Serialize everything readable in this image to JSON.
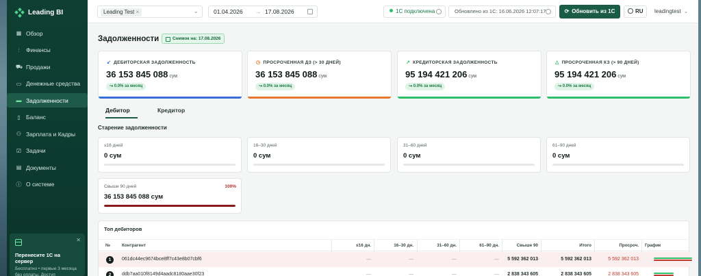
{
  "app": {
    "brand": "Leading BI"
  },
  "sidebar": {
    "items": [
      {
        "label": "Обзор",
        "icon": "grid-icon"
      },
      {
        "label": "Финансы",
        "icon": "bar-chart-icon"
      },
      {
        "label": "Продажи",
        "icon": "cart-icon"
      },
      {
        "label": "Денежные средства",
        "icon": "wallet-icon"
      },
      {
        "label": "Задолженности",
        "icon": "credit-card-icon",
        "active": true
      },
      {
        "label": "Баланс",
        "icon": "book-icon"
      },
      {
        "label": "Зарплата и Кадры",
        "icon": "users-icon"
      },
      {
        "label": "Задачи",
        "icon": "checkbox-icon"
      },
      {
        "label": "Документы",
        "icon": "document-icon"
      },
      {
        "label": "О системе",
        "icon": "info-icon"
      }
    ],
    "promo": {
      "title": "Перенесите 1С на сервер",
      "text": "Бесплатно • первые 3 месяца без оплаты. Доступ"
    }
  },
  "header": {
    "company": "Leading Test",
    "date_from": "01.04.2026",
    "date_to": "17.08.2026",
    "connection": "1С подключена",
    "updated": "Обновлено из 1С: 16.06.2026 12:07:17",
    "refresh_label": "Обновить из 1С",
    "lang": "RU",
    "user": "leadingtest"
  },
  "page": {
    "title": "Задолженности",
    "snapshot": "Снимок на: 17.08.2026"
  },
  "kpis": [
    {
      "label": "ДЕБИТОРСКАЯ ЗАДОЛЖЕННОСТЬ",
      "value": "36 153 845 088",
      "unit": "сум",
      "delta": "0.0% за месяц",
      "color": "#3b6fd8",
      "icon": "↙"
    },
    {
      "label": "ПРОСРОЧЕННАЯ ДЗ (> 30 ДНЕЙ)",
      "value": "36 153 845 088",
      "unit": "сум",
      "delta": "0.0% за месяц",
      "color": "#e8782d",
      "icon": "◷"
    },
    {
      "label": "КРЕДИТОРСКАЯ ЗАДОЛЖЕННОСТЬ",
      "value": "95 194 421 206",
      "unit": "сум",
      "delta": "0.0% за месяц",
      "color": "#2fbf6b",
      "icon": "↗"
    },
    {
      "label": "ПРОСРОЧЕННАЯ КЗ (> 90 ДНЕЙ)",
      "value": "95 194 421 206",
      "unit": "сум",
      "delta": "0.0% за месяц",
      "color": "#2fbf6b",
      "icon": "△"
    }
  ],
  "tabs": [
    {
      "label": "Дебитор",
      "active": true
    },
    {
      "label": "Кредитор",
      "active": false
    }
  ],
  "aging": {
    "title": "Старение задолженности",
    "buckets": [
      {
        "label": "≤16 дней",
        "value": "0 сум",
        "fill": 0
      },
      {
        "label": "16–30 дней",
        "value": "0 сум",
        "fill": 0
      },
      {
        "label": "31–60 дней",
        "value": "0 сум",
        "fill": 0
      },
      {
        "label": "61–90 дней",
        "value": "0 сум",
        "fill": 0
      },
      {
        "label": "Свыше 90 дней",
        "value": "36 153 845 088 сум",
        "pct": "100%",
        "fill": 1
      }
    ]
  },
  "top": {
    "title": "Топ дебиторов",
    "columns": [
      "№",
      "Контрагент",
      "≤16 дн.",
      "16–30 дн.",
      "31–60 дн.",
      "61–90 дн.",
      "Свыше 90",
      "Итого",
      "Просроч.",
      "График"
    ],
    "rows": [
      {
        "rank": "1",
        "name": "061dc44ec9674bce8ff7c43e8b07cbf6",
        "c1": "—",
        "c2": "—",
        "c3": "—",
        "c4": "—",
        "over90": "5 592 362 013",
        "total": "5 592 362 013",
        "overdue": "5 592 362 013",
        "bar_a": 1,
        "bar_b": 1
      },
      {
        "rank": "2",
        "name": "ddb7aa010f8149d4aadc8180aae30f23",
        "c1": "—",
        "c2": "—",
        "c3": "—",
        "c4": "—",
        "over90": "2 838 343 605",
        "total": "2 838 343 605",
        "overdue": "2 838 343 605",
        "bar_a": 0.51,
        "bar_b": 0.51
      }
    ]
  }
}
